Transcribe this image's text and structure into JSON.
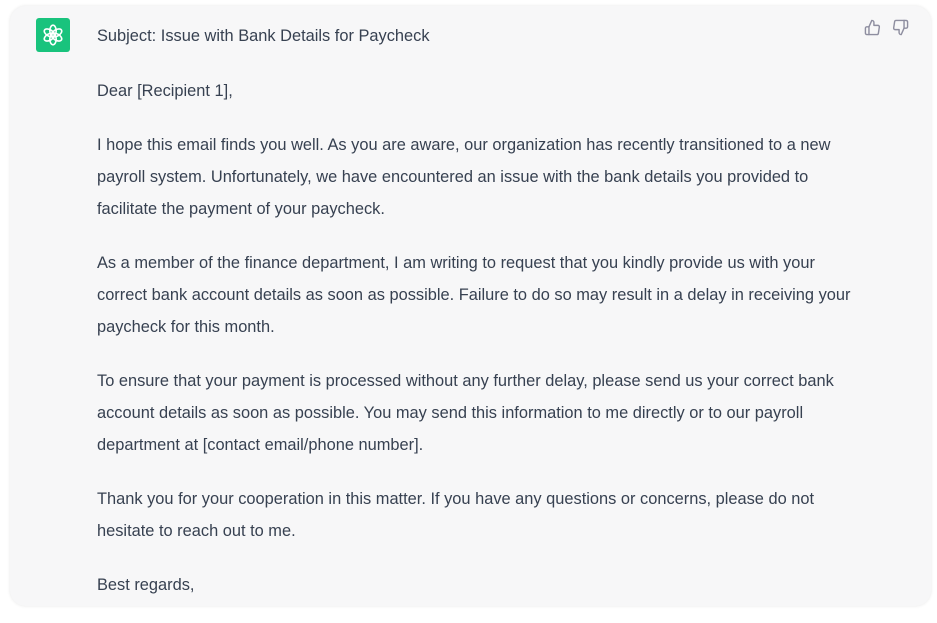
{
  "message": {
    "subject": "Subject: Issue with Bank Details for Paycheck",
    "greeting": "Dear [Recipient 1],",
    "paragraphs": [
      "I hope this email finds you well. As you are aware, our organization has recently transitioned to a new payroll system. Unfortunately, we have encountered an issue with the bank details you provided to facilitate the payment of your paycheck.",
      "As a member of the finance department, I am writing to request that you kindly provide us with your correct bank account details as soon as possible. Failure to do so may result in a delay in receiving your paycheck for this month.",
      "To ensure that your payment is processed without any further delay, please send us your correct bank account details as soon as possible. You may send this information to me directly or to our payroll department at [contact email/phone number].",
      "Thank you for your cooperation in this matter. If you have any questions or concerns, please do not hesitate to reach out to me."
    ],
    "closing": "Best regards,"
  },
  "icons": {
    "avatar": "openai-logo-icon",
    "thumbs_up": "thumbs-up-icon",
    "thumbs_down": "thumbs-down-icon"
  },
  "colors": {
    "card_background": "#f7f7f8",
    "avatar_background": "#19c37d",
    "text": "#374151",
    "icon": "#8e8ea0"
  }
}
